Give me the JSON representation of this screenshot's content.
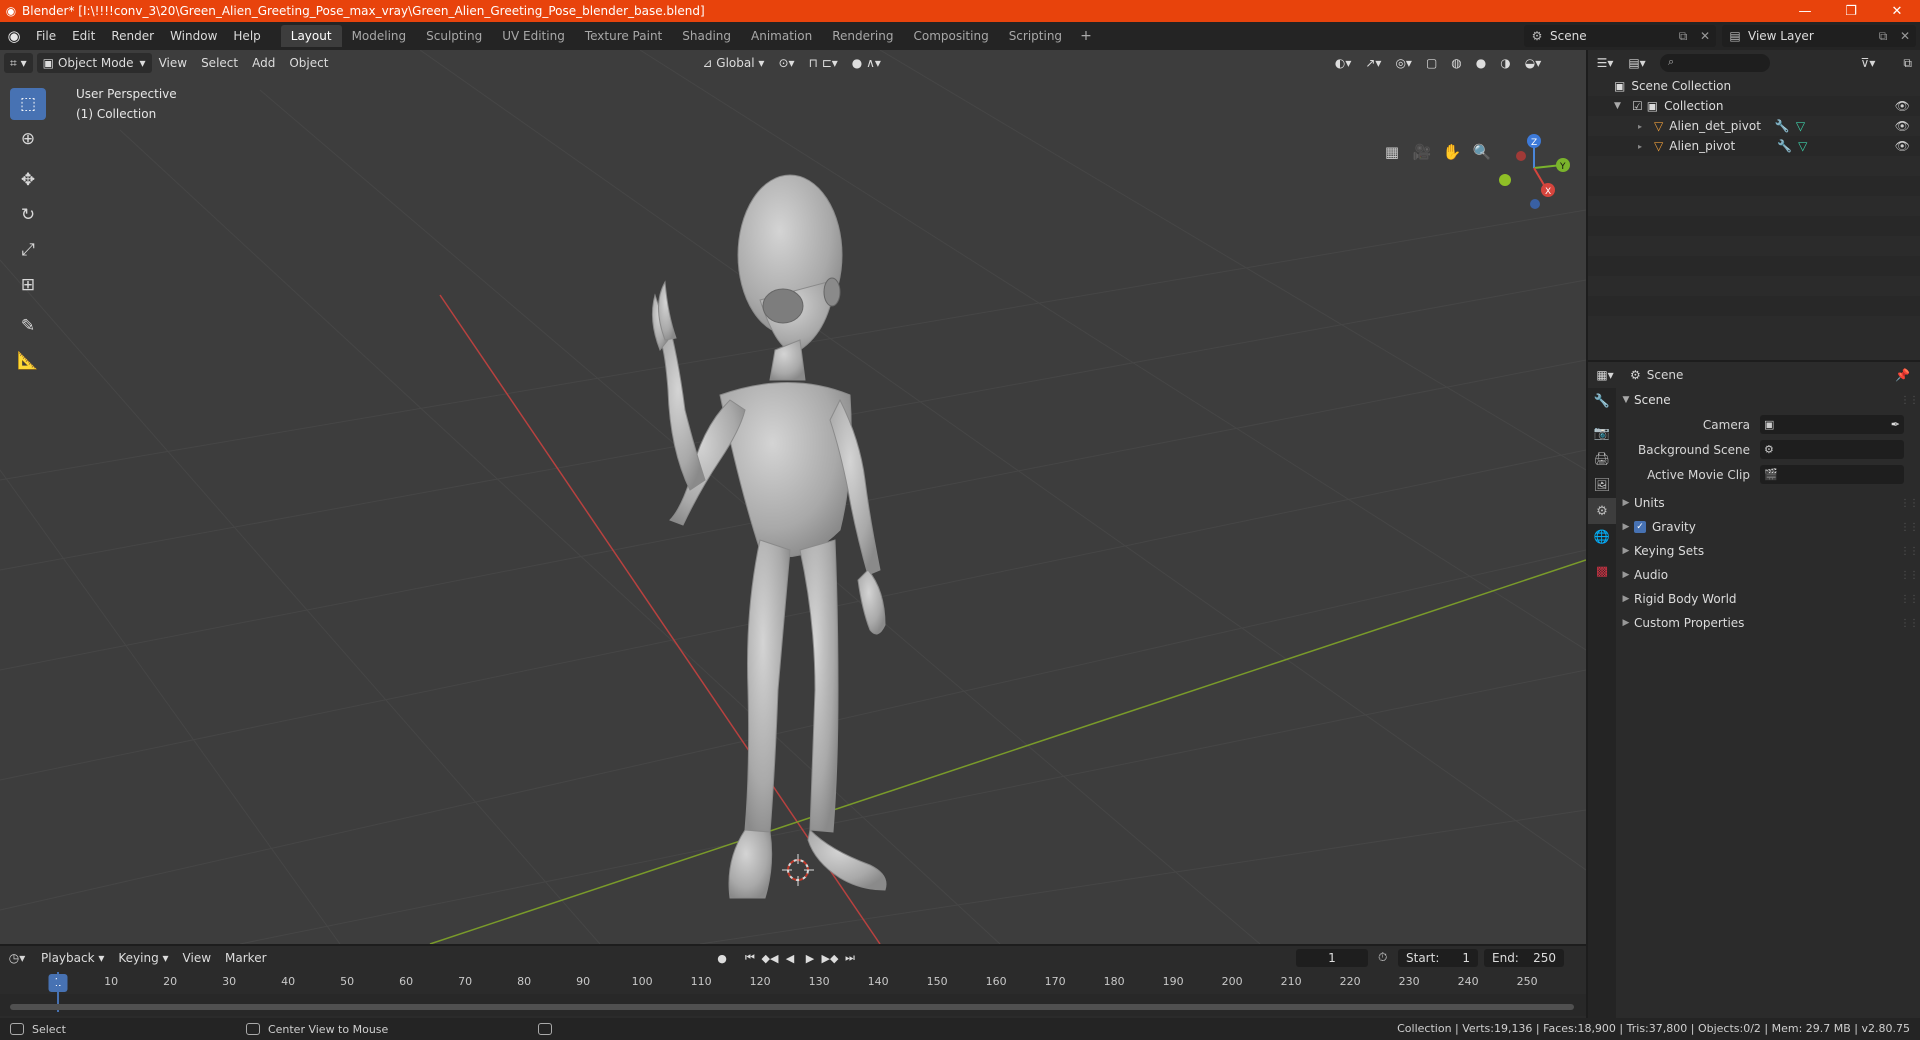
{
  "window": {
    "title": "Blender* [I:\\!!!!conv_3\\20\\Green_Alien_Greeting_Pose_max_vray\\Green_Alien_Greeting_Pose_blender_base.blend]",
    "minimize": "—",
    "maximize": "❐",
    "close": "✕"
  },
  "menu": {
    "items": [
      "File",
      "Edit",
      "Render",
      "Window",
      "Help"
    ],
    "workspaces": [
      "Layout",
      "Modeling",
      "Sculpting",
      "UV Editing",
      "Texture Paint",
      "Shading",
      "Animation",
      "Rendering",
      "Compositing",
      "Scripting"
    ],
    "active_workspace": "Layout",
    "scene": "Scene",
    "view_layer": "View Layer"
  },
  "viewport": {
    "mode": "Object Mode",
    "menus": [
      "View",
      "Select",
      "Add",
      "Object"
    ],
    "orientation": "Global",
    "perspective_label": "User Perspective",
    "collection_label": "(1) Collection",
    "gizmo_axes": [
      "X",
      "Y",
      "Z"
    ],
    "colors": {
      "background": "#3d3d3d",
      "grid": "#484848",
      "x_axis": "#b8413f",
      "y_axis": "#7a9b2a",
      "model": "#b8b8b8",
      "accent": "#4772b3"
    }
  },
  "outliner": {
    "root": "Scene Collection",
    "collection": "Collection",
    "objects": [
      "Alien_det_pivot",
      "Alien_pivot"
    ]
  },
  "properties": {
    "context": "Scene",
    "panel_title": "Scene",
    "fields": [
      {
        "label": "Camera",
        "value": ""
      },
      {
        "label": "Background Scene",
        "value": ""
      },
      {
        "label": "Active Movie Clip",
        "value": ""
      }
    ],
    "subpanels": [
      "Units",
      "Gravity",
      "Keying Sets",
      "Audio",
      "Rigid Body World",
      "Custom Properties"
    ],
    "gravity_checked": true
  },
  "timeline": {
    "menus": [
      "Playback",
      "Keying",
      "View",
      "Marker"
    ],
    "current_frame": "1",
    "start_label": "Start:",
    "start": "1",
    "end_label": "End:",
    "end": "250",
    "ticks": [
      "10",
      "20",
      "30",
      "40",
      "50",
      "60",
      "70",
      "80",
      "90",
      "100",
      "110",
      "120",
      "130",
      "140",
      "150",
      "160",
      "170",
      "180",
      "190",
      "200",
      "210",
      "220",
      "230",
      "240",
      "250"
    ]
  },
  "statusbar": {
    "left_action": "Select",
    "middle_action": "Center View to Mouse",
    "stats": "Collection | Verts:19,136 | Faces:18,900 | Tris:37,800 | Objects:0/2 | Mem: 29.7 MB | v2.80.75"
  }
}
